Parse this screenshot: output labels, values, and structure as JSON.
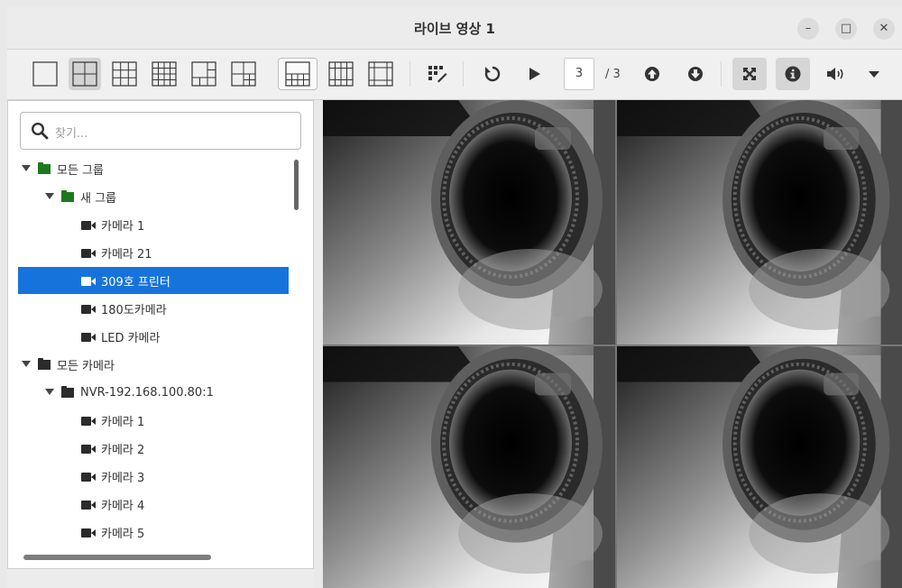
{
  "window": {
    "title": "라이브 영상 1"
  },
  "toolbar": {
    "layouts": [
      "1x1",
      "2x2",
      "3x3",
      "4x4",
      "1+5",
      "1+7",
      "1+12",
      "5x5",
      "frame"
    ],
    "page_current": "3",
    "page_total": "/ 3"
  },
  "search": {
    "placeholder": "찾기..."
  },
  "tree": [
    {
      "label": "모든 그룹",
      "type": "folder",
      "color": "#1c7a1c",
      "expanded": true
    },
    {
      "label": "새 그룹",
      "type": "folder",
      "color": "#1c7a1c",
      "expanded": true
    },
    {
      "label": "카메라 1",
      "type": "camera"
    },
    {
      "label": "카메라 21",
      "type": "camera"
    },
    {
      "label": "309호 프린터",
      "type": "camera",
      "selected": true
    },
    {
      "label": "180도카메라",
      "type": "camera"
    },
    {
      "label": "LED 카메라",
      "type": "camera"
    },
    {
      "label": "모든 카메라",
      "type": "folder",
      "color": "#2b2b2b",
      "expanded": true
    },
    {
      "label": "NVR-192.168.100.80:1",
      "type": "folder",
      "color": "#2b2b2b",
      "expanded": true
    },
    {
      "label": "카메라 1",
      "type": "camera"
    },
    {
      "label": "카메라 2",
      "type": "camera"
    },
    {
      "label": "카메라 3",
      "type": "camera"
    },
    {
      "label": "카메라 4",
      "type": "camera"
    },
    {
      "label": "카메라 5",
      "type": "camera"
    }
  ],
  "colors": {
    "selection": "#1773dc",
    "group_folder": "#1c7a1c"
  }
}
